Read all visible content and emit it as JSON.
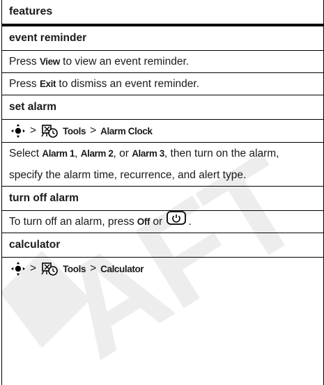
{
  "title": "features",
  "sections": [
    {
      "heading": "event reminder",
      "lines": [
        [
          "Press ",
          "View",
          " to view an event reminder."
        ],
        [
          "Press ",
          "Exit",
          " to dismiss an event reminder."
        ]
      ]
    },
    {
      "heading": "set alarm",
      "nav": {
        "sep": ">",
        "item": "Tools",
        "target": "Alarm Clock"
      },
      "text_a": "Select ",
      "k1": "Alarm 1",
      "text_b": ", ",
      "k2": "Alarm 2",
      "text_c": ", or ",
      "k3": "Alarm 3",
      "text_d": ", then turn on the alarm, specify the alarm time, recurrence, and alert type."
    },
    {
      "heading": "turn off alarm",
      "text_a": "To turn off an alarm, press ",
      "k1": "Off",
      "text_b": " or ",
      "text_c": "."
    },
    {
      "heading": "calculator",
      "nav": {
        "sep": ">",
        "item": "Tools",
        "target": "Calculator"
      }
    }
  ],
  "icons": [
    "nav-key-icon",
    "tools-icon",
    "power-key-icon"
  ],
  "watermark_color": "#ededed"
}
